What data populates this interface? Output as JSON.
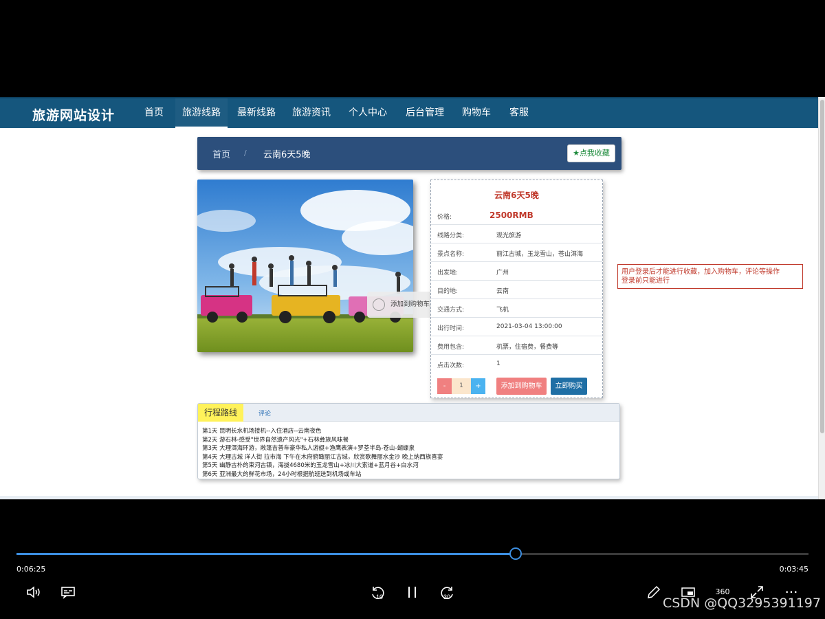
{
  "site": {
    "brand": "旅游网站设计"
  },
  "nav": [
    {
      "label": "首页"
    },
    {
      "label": "旅游线路",
      "active": true
    },
    {
      "label": "最新线路"
    },
    {
      "label": "旅游资讯"
    },
    {
      "label": "个人中心"
    },
    {
      "label": "后台管理"
    },
    {
      "label": "购物车"
    },
    {
      "label": "客服"
    }
  ],
  "breadcrumb": {
    "home": "首页",
    "separator": "/",
    "current": "云南6天5晚",
    "favorite_label": "点我收藏"
  },
  "toast": {
    "text": "添加到购物车成功"
  },
  "product": {
    "title": "云南6天5晚",
    "rows": [
      {
        "key": "价格:",
        "value": "2500RMB"
      },
      {
        "key": "线路分类:",
        "value": "观光旅游"
      },
      {
        "key": "景点名称:",
        "value": "丽江古城，玉龙雪山，苍山洱海"
      },
      {
        "key": "出发地:",
        "value": "广州"
      },
      {
        "key": "目的地:",
        "value": "云南"
      },
      {
        "key": "交通方式:",
        "value": "飞机"
      },
      {
        "key": "出行时间:",
        "value": "2021-03-04 13:00:00"
      },
      {
        "key": "费用包含:",
        "value": "机票，住宿费，餐费等"
      },
      {
        "key": "点击次数:",
        "value": "1"
      }
    ],
    "qty": {
      "minus": "-",
      "value": "1",
      "plus": "+"
    },
    "add_to_cart": "添加到购物车",
    "buy_now": "立即购买"
  },
  "notice": {
    "line1": "用户登录后才能进行收藏，加入购物车，评论等操作",
    "line2": "登录前只能进行"
  },
  "tabs": {
    "route": "行程路线",
    "comment": "评论"
  },
  "itinerary": [
    "第1天 昆明长水机场接机--入住酒店--云南夜色",
    "第2天 游石林-感受\"世界自然遗产风光\"+石林彝族风味餐",
    "第3天 大理洱海环游，敞篷吉普车豪华私人游艇+渔鹰表演+罗荃半岛-苍山-蝴蝶泉",
    "第4天 大理古城 洋人街 拉市海 下午在木府俯瞰丽江古城，欣赏歌舞丽水金沙 晚上纳西族喜宴",
    "第5天 幽静古朴的束河古镇，海拔4680米的玉龙雪山+冰川大索道+蓝月谷+白水河",
    "第6天 亚洲最大的鲜花市场，24小时根据航班送到机场或车站"
  ],
  "player": {
    "elapsed": "0:06:25",
    "remaining": "0:03:45",
    "progress_fraction": 0.63,
    "accent": "#3c8ee0",
    "controls": [
      "volume-icon",
      "subtitles-icon",
      "rewind-10-icon",
      "pause-icon",
      "forward-30-icon",
      "pen-icon",
      "miniview-icon",
      "360-icon",
      "fullscreen-icon",
      "more-icon"
    ],
    "rewind_label": "10",
    "forward_label": "30",
    "vr_label": "360",
    "more_label": "···"
  },
  "watermark": "CSDN @QQ3295391197"
}
